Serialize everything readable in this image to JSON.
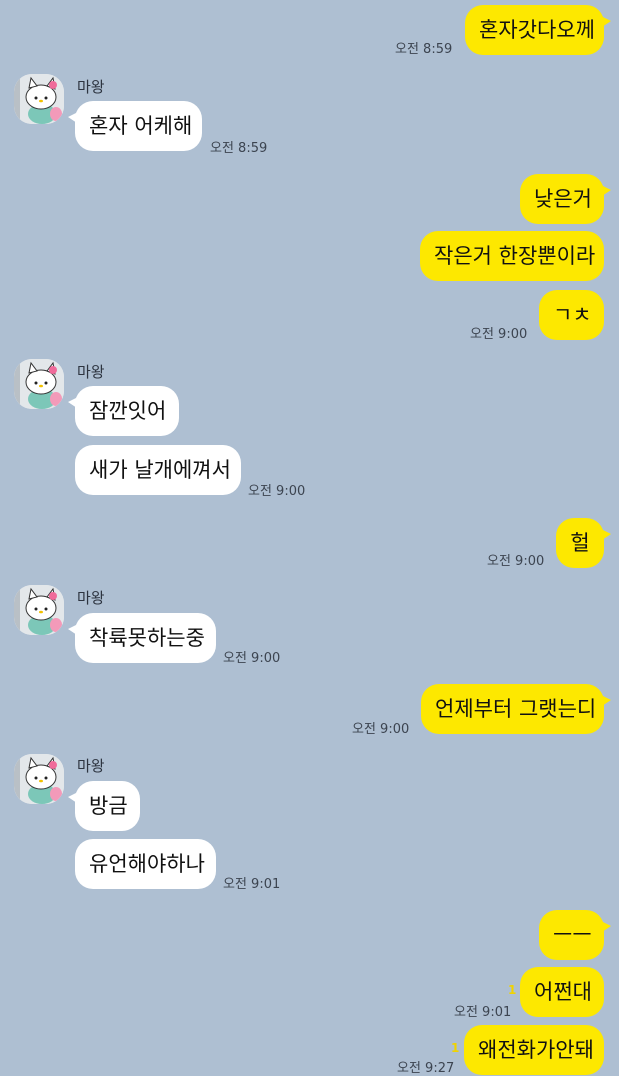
{
  "contact": {
    "name": "마왕"
  },
  "messages": {
    "m1": {
      "text": "혼자갓다오께",
      "time": "오전 8:59"
    },
    "m2": {
      "text": "혼자 어케해",
      "time": "오전 8:59"
    },
    "m3": {
      "text": "낮은거"
    },
    "m4": {
      "text": "작은거 한장뿐이라"
    },
    "m5": {
      "text": "ㄱㅊ",
      "time": "오전 9:00"
    },
    "m6": {
      "text": "잠깐잇어"
    },
    "m7": {
      "text": "새가 날개에껴서",
      "time": "오전 9:00"
    },
    "m8": {
      "text": "헐",
      "time": "오전 9:00"
    },
    "m9": {
      "text": "착륙못하는중",
      "time": "오전 9:00"
    },
    "m10": {
      "text": "언제부터 그랫는디",
      "time": "오전 9:00"
    },
    "m11": {
      "text": "방금"
    },
    "m12": {
      "text": "유언해야하나",
      "time": "오전 9:01"
    },
    "m13": {
      "text": "ㅡㅡ"
    },
    "m14": {
      "text": "어쩐대",
      "time": "오전 9:01",
      "unread": "1"
    },
    "m15": {
      "text": "왜전화가안돼",
      "time": "오전 9:27",
      "unread": "1"
    }
  },
  "colors": {
    "background": "#aebfd2",
    "my_bubble": "#fde800",
    "their_bubble": "#ffffff",
    "unread": "#f0d300"
  }
}
